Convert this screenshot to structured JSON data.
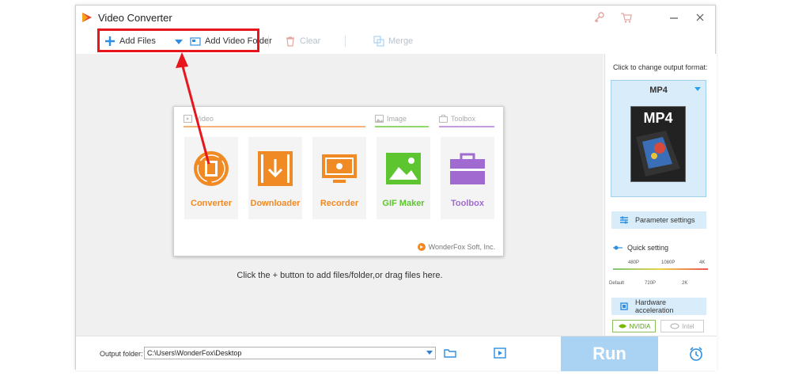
{
  "app": {
    "title": "Video Converter"
  },
  "toolbar": {
    "add_files": "Add Files",
    "add_video_folder": "Add Video Folder",
    "clear": "Clear",
    "merge": "Merge"
  },
  "launcher": {
    "sections": [
      "Video",
      "Image",
      "Toolbox"
    ],
    "tiles": [
      {
        "label": "Converter",
        "color": "#f08a24"
      },
      {
        "label": "Downloader",
        "color": "#f08a24"
      },
      {
        "label": "Recorder",
        "color": "#f08a24"
      },
      {
        "label": "GIF Maker",
        "color": "#5cc52f"
      },
      {
        "label": "Toolbox",
        "color": "#a06ad0"
      }
    ],
    "brand": "WonderFox Soft, Inc."
  },
  "workarea": {
    "hint": "Click the + button to add files/folder,or drag files here."
  },
  "right_panel": {
    "change_format_label": "Click to change output format:",
    "format": "MP4",
    "format_badge": "MP4",
    "parameter_settings": "Parameter settings",
    "quick_setting": "Quick setting",
    "quality_top": [
      "480P",
      "1080P",
      "4K"
    ],
    "quality_bottom": [
      "Default",
      "720P",
      "2K"
    ],
    "hardware_acceleration": "Hardware acceleration",
    "nvidia": "NVIDIA",
    "intel": "Intel"
  },
  "bottom": {
    "output_folder_label": "Output folder:",
    "output_folder_value": "C:\\Users\\WonderFox\\Desktop",
    "run": "Run"
  },
  "colors": {
    "accent": "#2e8fe0",
    "highlight": "#e8161c",
    "run": "#a9d2f3"
  },
  "icons": [
    "app-logo",
    "key-icon",
    "cart-icon",
    "minimize-icon",
    "close-icon",
    "plus-icon",
    "dropdown-caret",
    "folder-icon",
    "trash-icon",
    "merge-icon",
    "open-folder-icon",
    "preview-icon",
    "alarm-icon"
  ]
}
